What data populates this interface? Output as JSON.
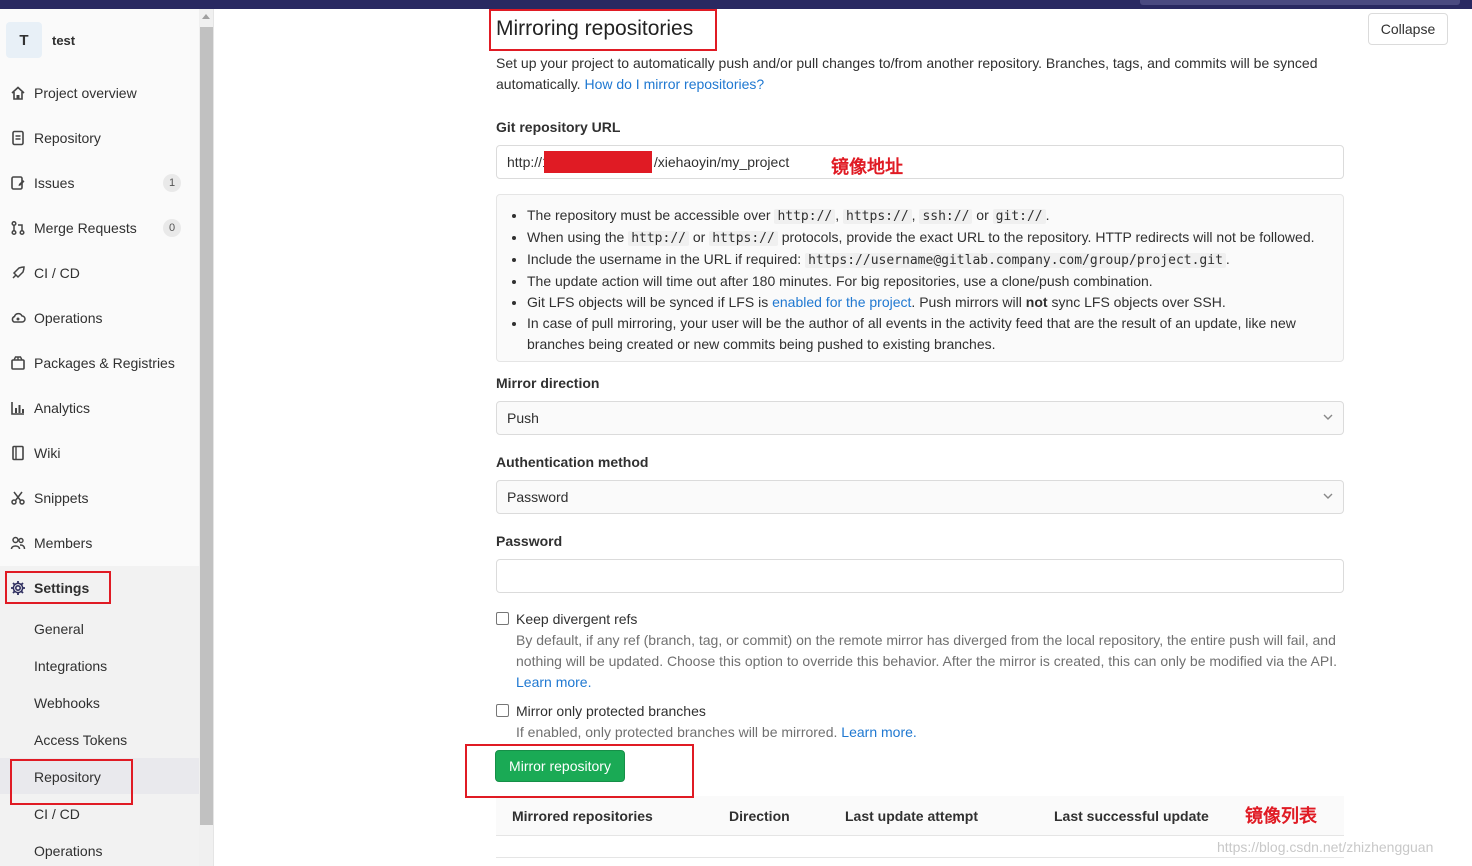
{
  "project": {
    "avatar_letter": "T",
    "name": "test"
  },
  "sidebar": {
    "items": [
      {
        "label": "Project overview",
        "icon": "home-icon"
      },
      {
        "label": "Repository",
        "icon": "document-icon"
      },
      {
        "label": "Issues",
        "icon": "issues-icon",
        "badge": "1"
      },
      {
        "label": "Merge Requests",
        "icon": "merge-request-icon",
        "badge": "0"
      },
      {
        "label": "CI / CD",
        "icon": "rocket-icon"
      },
      {
        "label": "Operations",
        "icon": "cloud-gear-icon"
      },
      {
        "label": "Packages & Registries",
        "icon": "package-icon"
      },
      {
        "label": "Analytics",
        "icon": "chart-icon"
      },
      {
        "label": "Wiki",
        "icon": "book-icon"
      },
      {
        "label": "Snippets",
        "icon": "scissors-icon"
      },
      {
        "label": "Members",
        "icon": "users-icon"
      },
      {
        "label": "Settings",
        "icon": "gear-icon"
      }
    ],
    "settings_sub": [
      "General",
      "Integrations",
      "Webhooks",
      "Access Tokens",
      "Repository",
      "CI / CD",
      "Operations"
    ]
  },
  "main": {
    "title": "Mirroring repositories",
    "collapse_label": "Collapse",
    "description": "Set up your project to automatically push and/or pull changes to/from another repository. Branches, tags, and commits will be synced automatically.",
    "description_link": "How do I mirror repositories?",
    "git_url_label": "Git repository URL",
    "git_url_prefix": "http://1",
    "git_url_suffix": "/xiehaoyin/my_project",
    "git_url_note": "镜像地址",
    "info": {
      "l1_a": "The repository must be accessible over",
      "l1_c1": "http://",
      "l1_c2": "https://",
      "l1_c3": "ssh://",
      "l1_or": "or",
      "l1_c4": "git://",
      "l2_a": "When using the",
      "l2_c1": "http://",
      "l2_or": "or",
      "l2_c2": "https://",
      "l2_b": "protocols, provide the exact URL to the repository. HTTP redirects will not be followed.",
      "l3_a": "Include the username in the URL if required:",
      "l3_c": "https://username@gitlab.company.com/group/project.git",
      "l4": "The update action will time out after 180 minutes. For big repositories, use a clone/push combination.",
      "l5_a": "Git LFS objects will be synced if LFS is",
      "l5_link": "enabled for the project",
      "l5_b": ". Push mirrors will",
      "l5_bold": "not",
      "l5_c": "sync LFS objects over SSH.",
      "l6": "In case of pull mirroring, your user will be the author of all events in the activity feed that are the result of an update, like new branches being created or new commits being pushed to existing branches."
    },
    "mirror_direction_label": "Mirror direction",
    "mirror_direction_value": "Push",
    "auth_label": "Authentication method",
    "auth_value": "Password",
    "password_label": "Password",
    "keep_refs_label": "Keep divergent refs",
    "keep_refs_help": "By default, if any ref (branch, tag, or commit) on the remote mirror has diverged from the local repository, the entire push will fail, and nothing will be updated. Choose this option to override this behavior. After the mirror is created, this can only be modified via the API.",
    "keep_refs_link": "Learn more.",
    "protected_label": "Mirror only protected branches",
    "protected_help": "If enabled, only protected branches will be mirrored.",
    "protected_link": "Learn more.",
    "mirror_button": "Mirror repository",
    "table_headers": [
      "Mirrored repositories",
      "Direction",
      "Last update attempt",
      "Last successful update"
    ],
    "table_note": "镜像列表"
  },
  "watermark": "https://blog.csdn.net/zhizhengguan",
  "colors": {
    "accent": "#1f78d1",
    "button_green": "#1aaa55",
    "highlight_red": "#e01b24",
    "topbar": "#292961"
  }
}
